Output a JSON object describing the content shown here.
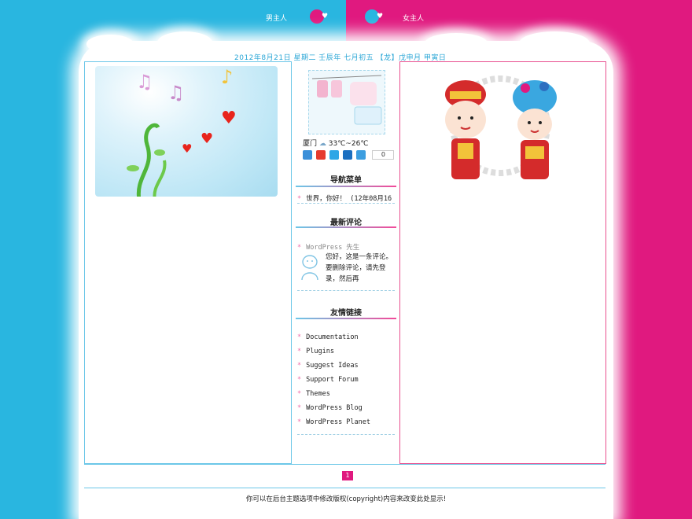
{
  "header": {
    "male_label": "男主人",
    "female_label": "女主人",
    "date_line": "2012年8月21日 星期二  壬辰年  七月初五 【龙】戊申月  甲寅日"
  },
  "sidebar": {
    "weather": {
      "city": "厦门",
      "temperature": "33℃~26℃"
    },
    "share_count": "0",
    "nav_title": "导航菜单",
    "nav_items": [
      {
        "label": "世界，你好！  (12年08月16"
      }
    ],
    "comments_title": "最新评论",
    "comment": {
      "author": "WordPress 先生",
      "text": "您好，这是一条评论。要删除评论，请先登录，然后再"
    },
    "links_title": "友情链接",
    "links": [
      {
        "label": "Documentation"
      },
      {
        "label": "Plugins"
      },
      {
        "label": "Suggest Ideas"
      },
      {
        "label": "Support Forum"
      },
      {
        "label": "Themes"
      },
      {
        "label": "WordPress Blog"
      },
      {
        "label": "WordPress Planet"
      }
    ]
  },
  "pager": {
    "current": "1"
  },
  "footer": {
    "text": "你可以在后台主题选项中修改版权(copyright)内容来改变此处显示!"
  },
  "colors": {
    "left": "#29b6e0",
    "right": "#e0197f"
  },
  "icons": [
    "male-avatar-icon",
    "female-avatar-icon",
    "cloud-weather-icon",
    "share-icons"
  ]
}
